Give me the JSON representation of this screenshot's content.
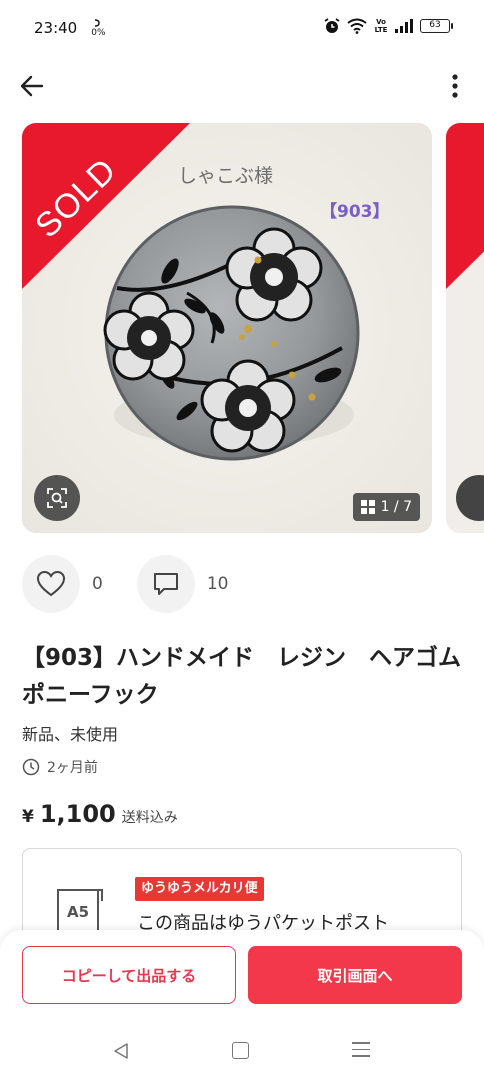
{
  "status_bar": {
    "time": "23:40",
    "data_rate": "0%",
    "battery": "63",
    "network_label": "Vo LTE"
  },
  "app_bar": {
    "back_icon": "arrow-left-icon",
    "more_icon": "more-vertical-icon"
  },
  "gallery": {
    "sold_label": "SOLD",
    "caption": "しゃこぶ様",
    "tag": "【903】",
    "counter": "1 / 7",
    "zoom_icon": "image-search-icon"
  },
  "actions": {
    "like_count": "0",
    "comment_count": "10"
  },
  "item": {
    "title": "【903】ハンドメイド　レジン　ヘアゴム　ポニーフック",
    "condition": "新品、未使用",
    "posted": "2ヶ月前",
    "price_currency": "¥",
    "price_amount": "1,100",
    "price_note": "送料込み"
  },
  "shipping": {
    "size_label": "A5",
    "badge": "ゆうゆうメルカリ便",
    "text": "この商品はゆうパケットポスト"
  },
  "bottom": {
    "copy_label": "コピーして出品する",
    "trade_label": "取引画面へ"
  },
  "colors": {
    "accent_red": "#f2384a",
    "sold_red": "#e8192c",
    "tag_purple": "#7a5ec8"
  }
}
